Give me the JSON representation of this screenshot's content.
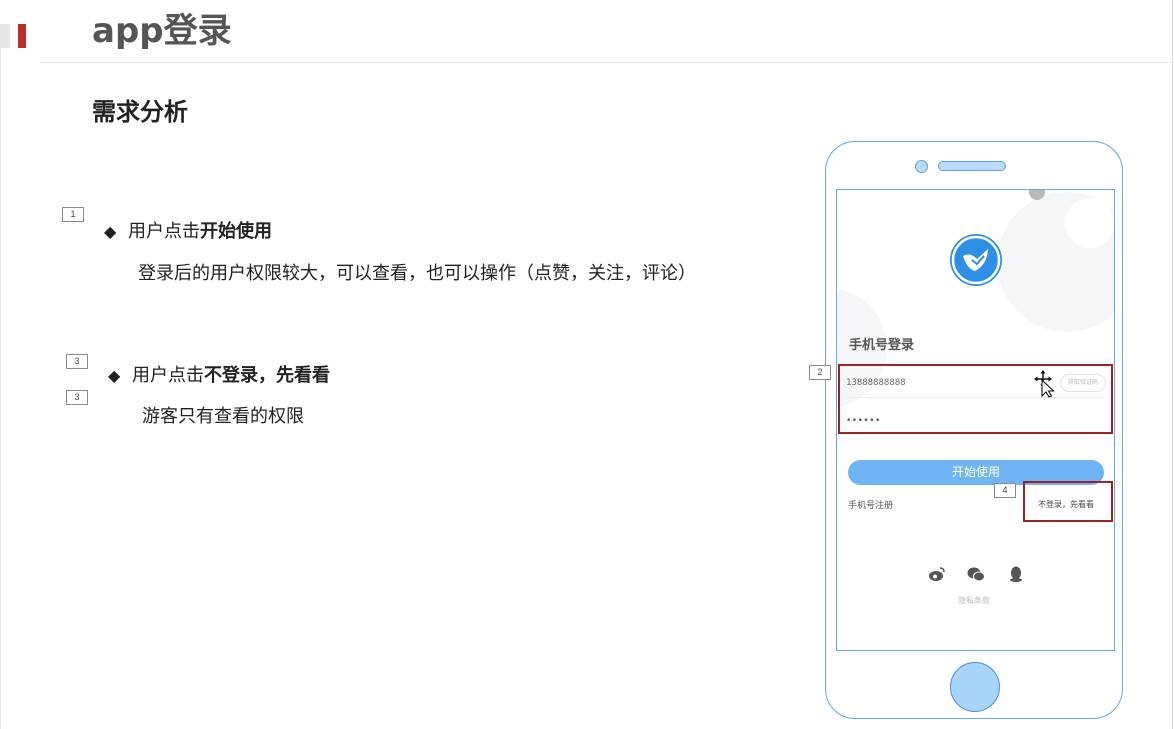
{
  "slide": {
    "title": "app登录",
    "subtitle": "需求分析"
  },
  "points": [
    {
      "marker": "1",
      "prefix": "用户点击",
      "emphasis": "开始使用",
      "description": "登录后的用户权限较大，可以查看，也可以操作（点赞，关注，评论）"
    },
    {
      "marker": "3",
      "prefix": "用户点击",
      "emphasis": "不登录，先看看",
      "description": "游客只有查看的权限"
    }
  ],
  "extra_marker": "3",
  "bullet_glyph": "◆",
  "phone": {
    "screen_title": "手机号登录",
    "phone_value": "13888888888",
    "sms_button": "获取验证码",
    "password_value": "••••••",
    "start_button": "开始使用",
    "register_link": "手机号注册",
    "skip_link": "不登录，先看看",
    "privacy_link": "隐私条款",
    "social_icons": [
      "weibo-icon",
      "wechat-icon",
      "qq-icon"
    ]
  },
  "callouts": {
    "inputs_marker": "2",
    "skip_marker": "4"
  },
  "colors": {
    "accent_red": "#b8312f",
    "phone_outline": "#63a8e4",
    "button_blue": "#6fb5f5",
    "highlight_box": "#9f2222"
  }
}
